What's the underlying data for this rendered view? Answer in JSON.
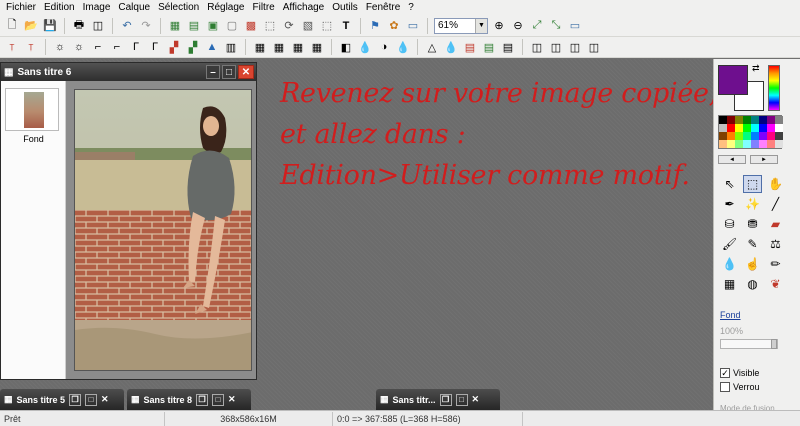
{
  "menu": [
    "Fichier",
    "Edition",
    "Image",
    "Calque",
    "Sélection",
    "Réglage",
    "Filtre",
    "Affichage",
    "Outils",
    "Fenêtre",
    "?"
  ],
  "toolbar": {
    "zoom_value": "61%",
    "icons_row1": [
      "new-icon",
      "open-icon",
      "save-icon",
      "print-icon",
      "print-preview-icon",
      "undo-icon",
      "redo-icon",
      "copy-icon",
      "paste-icon",
      "crop-icon",
      "image-icon",
      "colors-icon",
      "resize-icon",
      "rotate-icon",
      "layer-icon",
      "select-icon",
      "text-icon",
      "effects-icon",
      "plugin-icon",
      "window-icon"
    ],
    "icons_row2_count": 30
  },
  "document": {
    "title": "Sans titre 6",
    "layer_name": "Fond"
  },
  "minimized": [
    {
      "title": "Sans titre 5"
    },
    {
      "title": "Sans titre 8"
    },
    {
      "title": "Sans titr..."
    }
  ],
  "instruction": {
    "line1": "Revenez sur votre image copiée,",
    "line2": "et allez dans :",
    "line3": "Edition>Utiliser comme motif."
  },
  "colors": {
    "foreground": "#6e0f8e",
    "background": "#ffffff",
    "instruction_text": "#d11d1d"
  },
  "right_panel": {
    "layer_label": "Fond",
    "opacity": "100%",
    "visible_label": "Visible",
    "lock_label": "Verrou",
    "mode_label": "Mode de fusion"
  },
  "status": {
    "left": "Prêt",
    "size": "368x586x16M",
    "coords": "0:0 => 367:585 (L=368  H=586)"
  }
}
